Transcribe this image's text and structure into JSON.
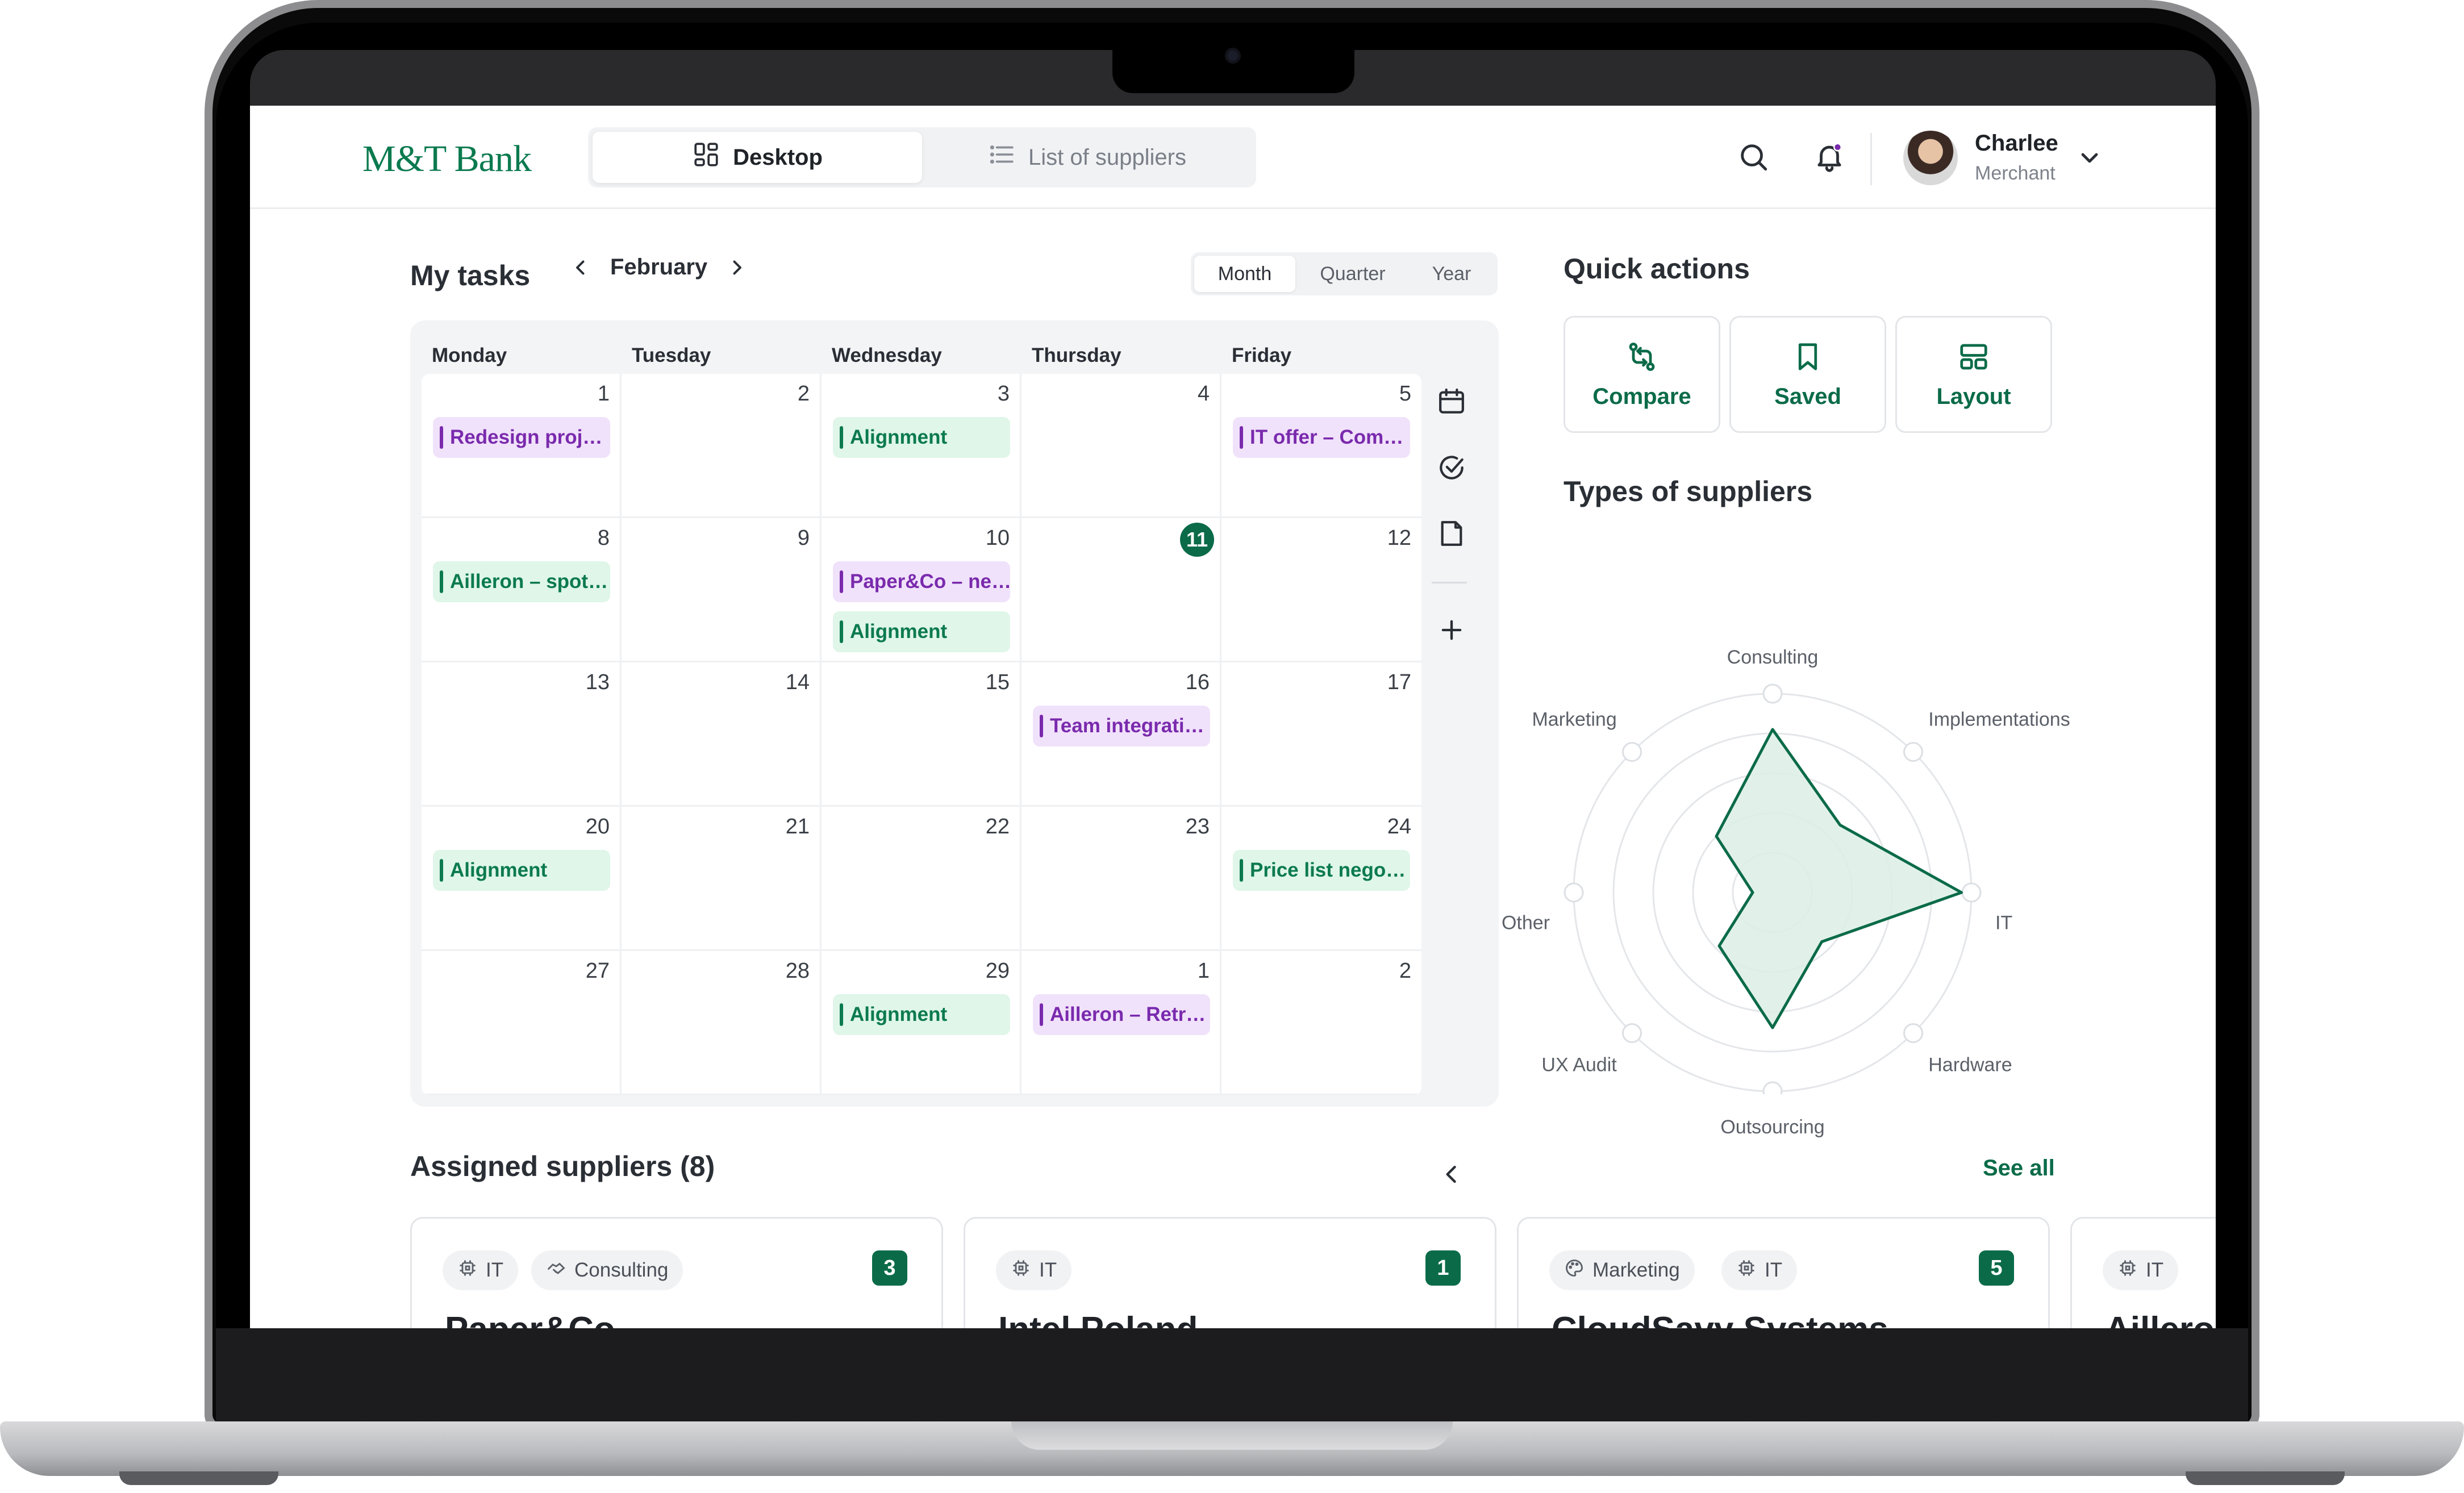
{
  "header": {
    "logo_text": "M&T Bank",
    "tabs": [
      {
        "label": "Desktop",
        "icon": "grid-icon",
        "active": true
      },
      {
        "label": "List of suppliers",
        "icon": "list-icon",
        "active": false
      }
    ],
    "user": {
      "name": "Charlee",
      "role": "Merchant"
    }
  },
  "tasks": {
    "title": "My tasks",
    "month": "February",
    "ranges": [
      "Month",
      "Quarter",
      "Year"
    ],
    "active_range": "Month",
    "weekdays": [
      "Monday",
      "Tuesday",
      "Wednesday",
      "Thursday",
      "Friday"
    ],
    "weeks": [
      [
        {
          "day": "1",
          "events": [
            {
              "label": "Redesign proj…",
              "color": "purple"
            }
          ]
        },
        {
          "day": "2",
          "events": []
        },
        {
          "day": "3",
          "events": [
            {
              "label": "Alignment",
              "color": "green"
            }
          ]
        },
        {
          "day": "4",
          "events": []
        },
        {
          "day": "5",
          "events": [
            {
              "label": "IT offer – Com…",
              "color": "purple"
            }
          ]
        }
      ],
      [
        {
          "day": "8",
          "events": [
            {
              "label": "Ailleron – spot…",
              "color": "green"
            }
          ]
        },
        {
          "day": "9",
          "events": []
        },
        {
          "day": "10",
          "events": [
            {
              "label": "Paper&Co – ne…",
              "color": "purple"
            },
            {
              "label": "Alignment",
              "color": "green"
            }
          ]
        },
        {
          "day": "11",
          "today": true,
          "events": []
        },
        {
          "day": "12",
          "events": []
        }
      ],
      [
        {
          "day": "13",
          "events": []
        },
        {
          "day": "14",
          "events": []
        },
        {
          "day": "15",
          "events": []
        },
        {
          "day": "16",
          "events": [
            {
              "label": "Team integrati…",
              "color": "purple"
            }
          ]
        },
        {
          "day": "17",
          "events": []
        }
      ],
      [
        {
          "day": "20",
          "events": [
            {
              "label": "Alignment",
              "color": "green"
            }
          ]
        },
        {
          "day": "21",
          "events": []
        },
        {
          "day": "22",
          "events": []
        },
        {
          "day": "23",
          "events": []
        },
        {
          "day": "24",
          "events": [
            {
              "label": "Price list nego…",
              "color": "green"
            }
          ]
        }
      ],
      [
        {
          "day": "27",
          "events": []
        },
        {
          "day": "28",
          "events": []
        },
        {
          "day": "29",
          "events": [
            {
              "label": "Alignment",
              "color": "green"
            }
          ]
        },
        {
          "day": "1",
          "events": [
            {
              "label": "Ailleron – Retr…",
              "color": "purple"
            }
          ]
        },
        {
          "day": "2",
          "events": []
        }
      ]
    ],
    "tools": [
      "calendar-icon",
      "check-circle-icon",
      "document-icon",
      "plus-icon",
      "chevron-left-icon"
    ]
  },
  "quick_actions": {
    "title": "Quick actions",
    "items": [
      {
        "label": "Compare",
        "icon": "compare-arrows-icon"
      },
      {
        "label": "Saved",
        "icon": "bookmark-icon"
      },
      {
        "label": "Layout",
        "icon": "layout-icon"
      }
    ]
  },
  "supplier_types": {
    "title": "Types of suppliers",
    "chart_data": {
      "type": "radar",
      "title": "Types of suppliers",
      "axes": [
        "Consulting",
        "Implementations",
        "IT",
        "Hardware",
        "Outsourcing",
        "UX Audit",
        "Other",
        "Marketing"
      ],
      "values": [
        0.82,
        0.48,
        0.95,
        0.35,
        0.68,
        0.38,
        0.1,
        0.4
      ],
      "max": 1,
      "rings": 5,
      "color": "#0b6b49",
      "fill": "#dcefe5"
    }
  },
  "assigned": {
    "title": "Assigned suppliers (8)",
    "see_all": "See all",
    "cards": [
      {
        "tags": [
          {
            "label": "IT",
            "icon": "chip-icon"
          },
          {
            "label": "Consulting",
            "icon": "handshake-icon"
          }
        ],
        "count": "3",
        "name": "Paper&Co"
      },
      {
        "tags": [
          {
            "label": "IT",
            "icon": "chip-icon"
          }
        ],
        "count": "1",
        "name": "Intel Poland"
      },
      {
        "tags": [
          {
            "label": "Marketing",
            "icon": "palette-icon"
          },
          {
            "label": "IT",
            "icon": "chip-icon"
          }
        ],
        "count": "5",
        "name": "CloudSavy Systems"
      },
      {
        "tags": [
          {
            "label": "IT",
            "icon": "chip-icon"
          }
        ],
        "count": "",
        "name": "Ailleron"
      }
    ]
  },
  "colors": {
    "brand": "#0b6b49",
    "event_purple": "#7a2aad",
    "event_green": "#0b7a4f"
  }
}
